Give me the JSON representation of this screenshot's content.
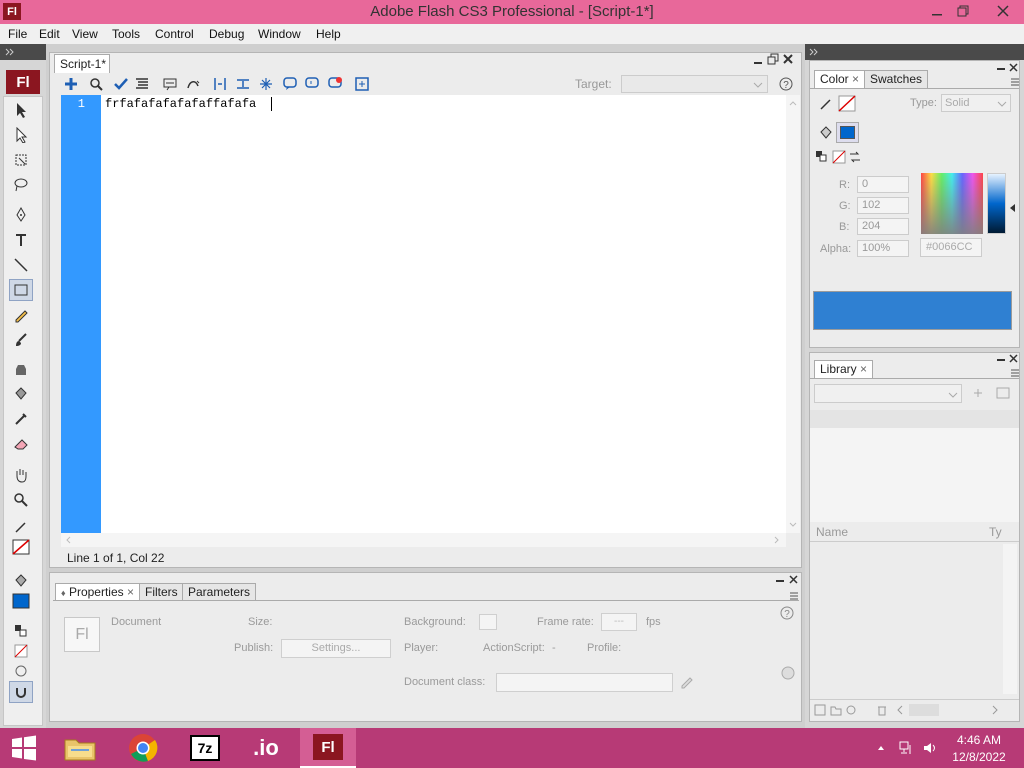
{
  "window": {
    "title": "Adobe Flash CS3 Professional - [Script-1*]",
    "app_icon": "Fl",
    "controls": [
      "minimize-icon",
      "restore-icon",
      "close-icon"
    ]
  },
  "menu": {
    "items": [
      "File",
      "Edit",
      "View",
      "Tools",
      "Control",
      "Debug",
      "Window",
      "Help"
    ]
  },
  "toolbar": {
    "badge": "Fl"
  },
  "script": {
    "tab_label": "Script-1*",
    "target_label": "Target:",
    "target_value": "",
    "line_number": "1",
    "code": "frfafafafafafaffafafa",
    "status": "Line 1 of 1, Col 22"
  },
  "properties": {
    "tabs": [
      "Properties",
      "Filters",
      "Parameters"
    ],
    "doc_icon": "Fl",
    "document_label": "Document",
    "size_label": "Size:",
    "background_label": "Background:",
    "frame_rate_label": "Frame rate:",
    "frame_rate_value": "---",
    "fps_label": "fps",
    "publish_label": "Publish:",
    "settings_button": "Settings...",
    "player_label": "Player:",
    "actionscript_label": "ActionScript:",
    "actionscript_value": "-",
    "profile_label": "Profile:",
    "doc_class_label": "Document class:",
    "doc_class_value": ""
  },
  "color": {
    "tabs": [
      "Color",
      "Swatches"
    ],
    "type_label": "Type:",
    "type_value": "Solid",
    "r_label": "R:",
    "r_value": "0",
    "g_label": "G:",
    "g_value": "102",
    "b_label": "B:",
    "b_value": "204",
    "alpha_label": "Alpha:",
    "alpha_value": "100%",
    "hex_value": "#0066CC",
    "fill_color": "#0066CC"
  },
  "library": {
    "tab": "Library",
    "name_col": "Name",
    "type_col": "Ty"
  },
  "taskbar": {
    "apps": [
      "file-explorer-icon",
      "chrome-icon",
      "7zip-icon",
      "jio-icon",
      "flash-icon"
    ],
    "seven_zip_label": "7z",
    "jio_label": ".io",
    "flash_label": "Fl",
    "time": "4:46 AM",
    "date": "12/8/2022",
    "accent": "#b73a76"
  }
}
